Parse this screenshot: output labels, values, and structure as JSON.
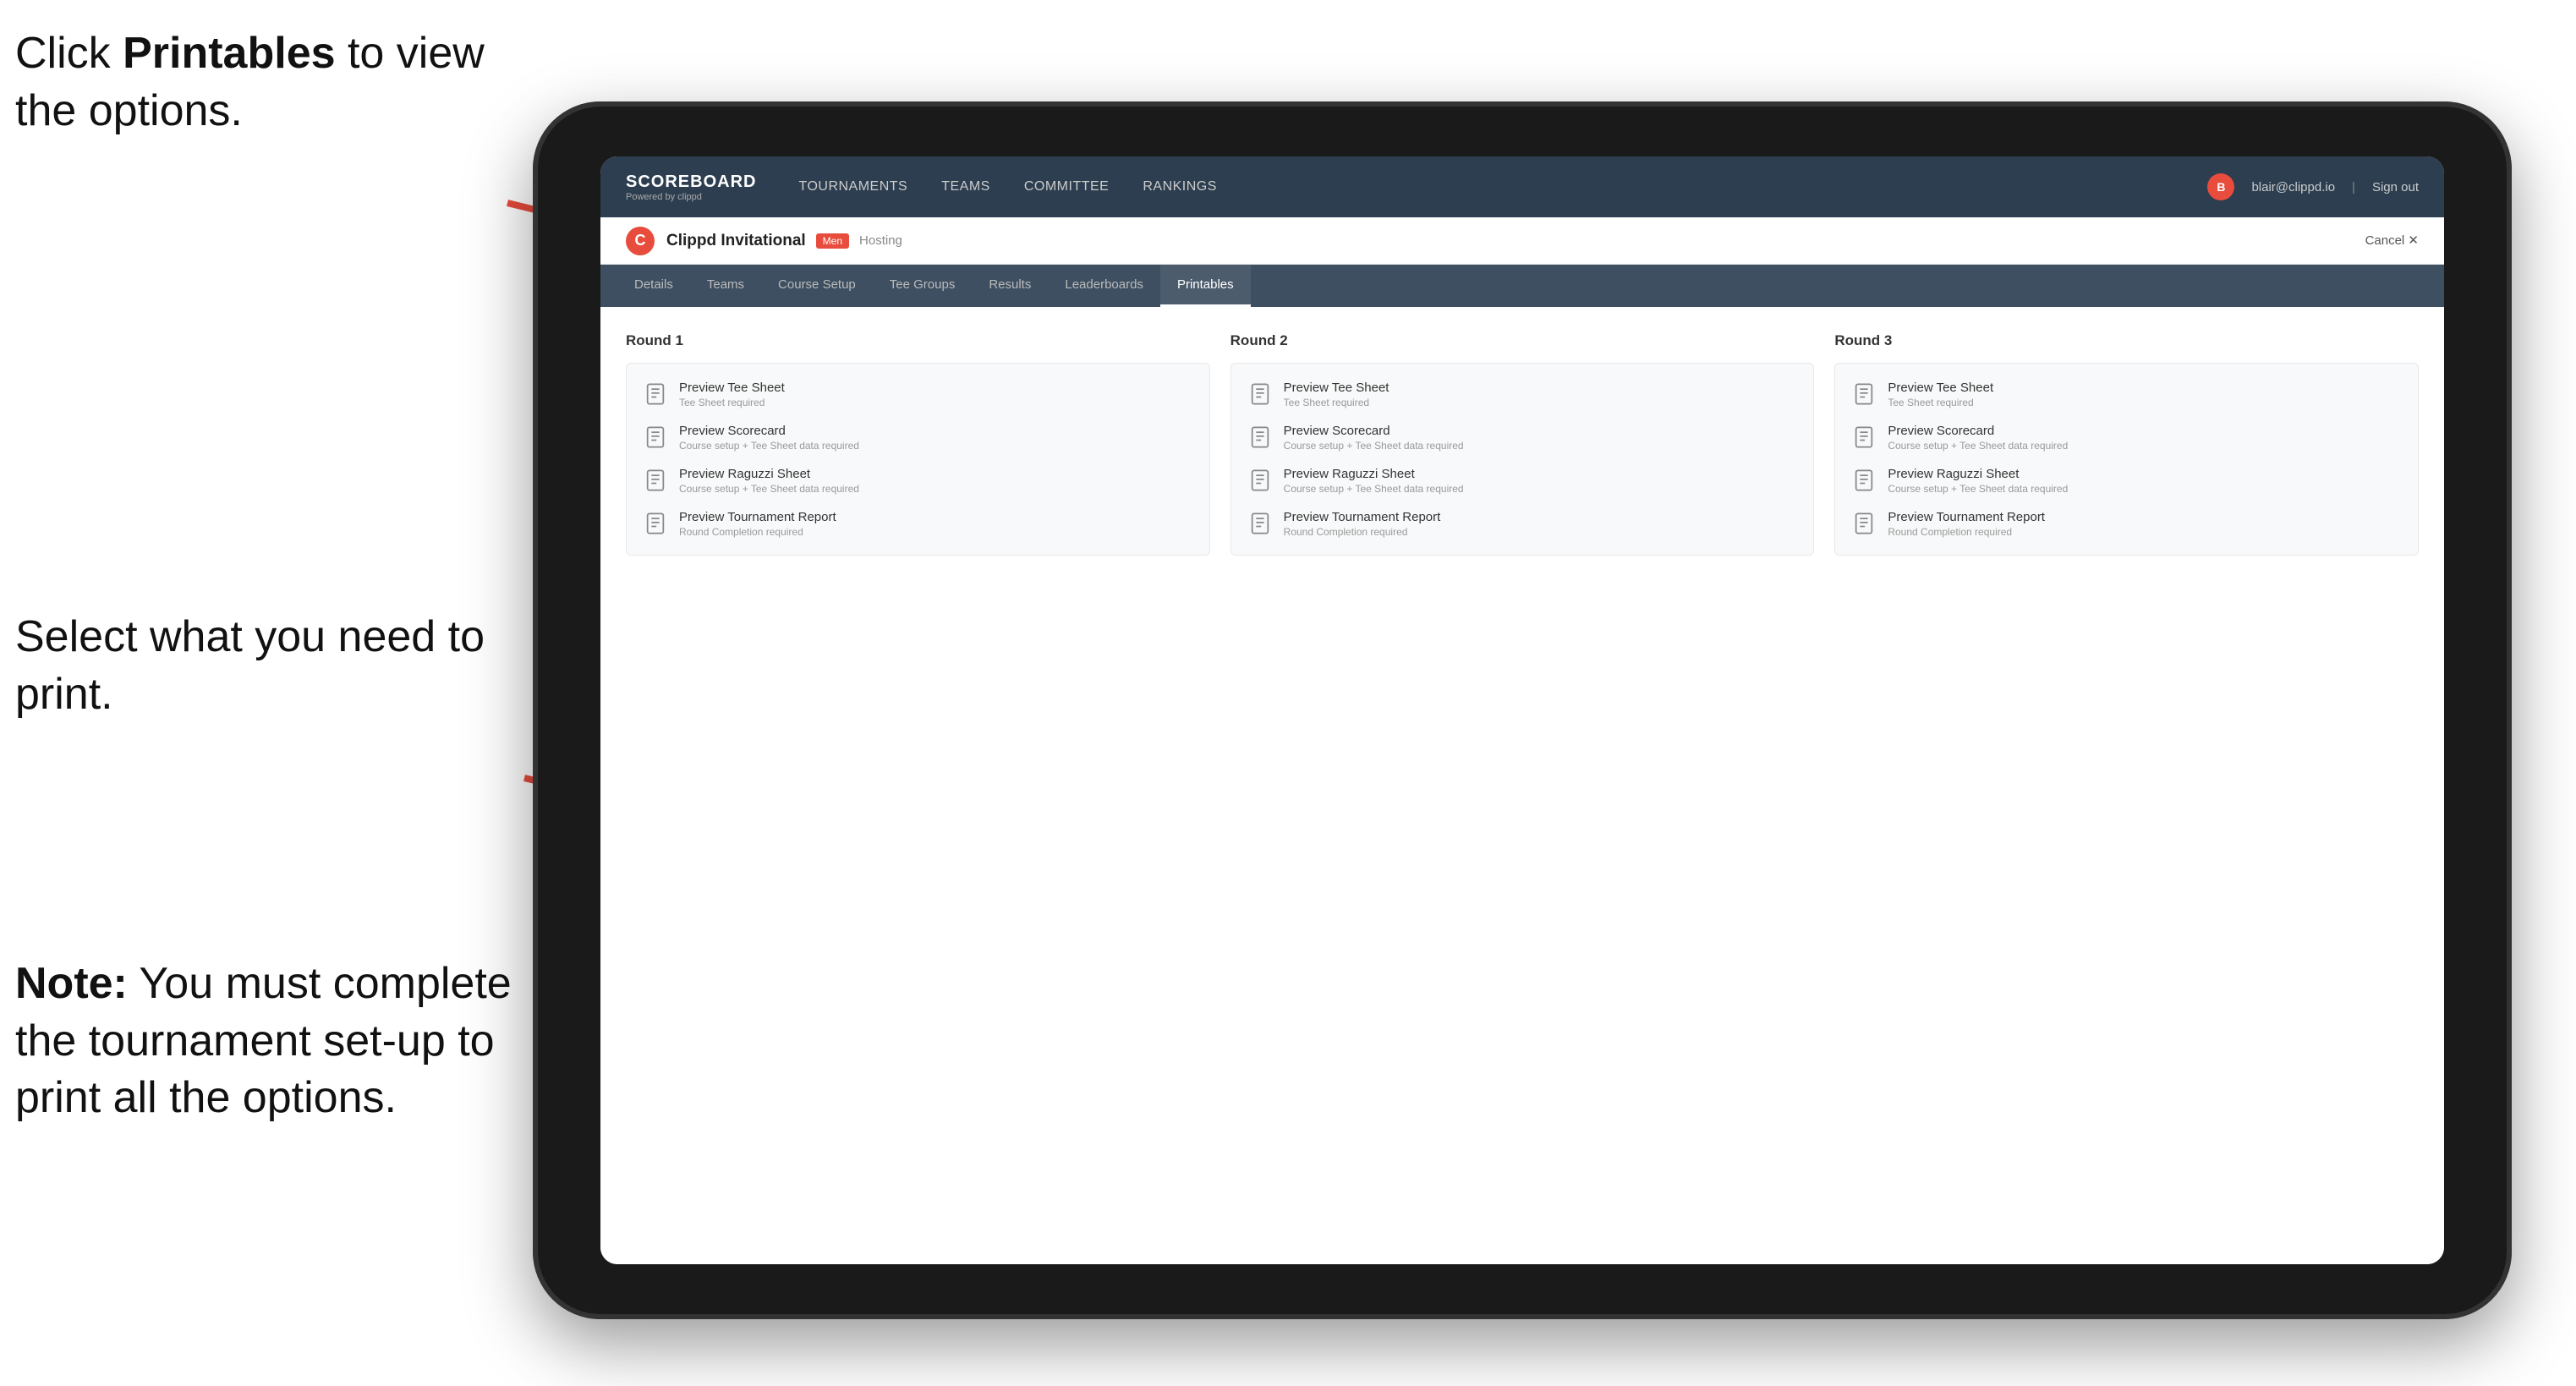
{
  "annotations": {
    "top": {
      "pre": "Click ",
      "bold": "Printables",
      "post": " to view the options."
    },
    "mid": {
      "text": "Select what you need to print."
    },
    "bot": {
      "pre": "",
      "bold": "Note:",
      "post": " You must complete the tournament set-up to print all the options."
    }
  },
  "nav": {
    "logo_title": "SCOREBOARD",
    "logo_sub": "Powered by clippd",
    "links": [
      "TOURNAMENTS",
      "TEAMS",
      "COMMITTEE",
      "RANKINGS"
    ],
    "user_email": "blair@clippd.io",
    "sign_out": "Sign out",
    "separator": "|"
  },
  "sub_header": {
    "tournament_initial": "C",
    "tournament_name": "Clippd Invitational",
    "badge": "Men",
    "status": "Hosting",
    "cancel": "Cancel ✕"
  },
  "tabs": [
    {
      "label": "Details"
    },
    {
      "label": "Teams"
    },
    {
      "label": "Course Setup"
    },
    {
      "label": "Tee Groups"
    },
    {
      "label": "Results"
    },
    {
      "label": "Leaderboards"
    },
    {
      "label": "Printables",
      "active": true
    }
  ],
  "rounds": [
    {
      "title": "Round 1",
      "items": [
        {
          "title": "Preview Tee Sheet",
          "sub": "Tee Sheet required"
        },
        {
          "title": "Preview Scorecard",
          "sub": "Course setup + Tee Sheet data required"
        },
        {
          "title": "Preview Raguzzi Sheet",
          "sub": "Course setup + Tee Sheet data required"
        },
        {
          "title": "Preview Tournament Report",
          "sub": "Round Completion required"
        }
      ]
    },
    {
      "title": "Round 2",
      "items": [
        {
          "title": "Preview Tee Sheet",
          "sub": "Tee Sheet required"
        },
        {
          "title": "Preview Scorecard",
          "sub": "Course setup + Tee Sheet data required"
        },
        {
          "title": "Preview Raguzzi Sheet",
          "sub": "Course setup + Tee Sheet data required"
        },
        {
          "title": "Preview Tournament Report",
          "sub": "Round Completion required"
        }
      ]
    },
    {
      "title": "Round 3",
      "items": [
        {
          "title": "Preview Tee Sheet",
          "sub": "Tee Sheet required"
        },
        {
          "title": "Preview Scorecard",
          "sub": "Course setup + Tee Sheet data required"
        },
        {
          "title": "Preview Raguzzi Sheet",
          "sub": "Course setup + Tee Sheet data required"
        },
        {
          "title": "Preview Tournament Report",
          "sub": "Round Completion required"
        }
      ]
    }
  ]
}
